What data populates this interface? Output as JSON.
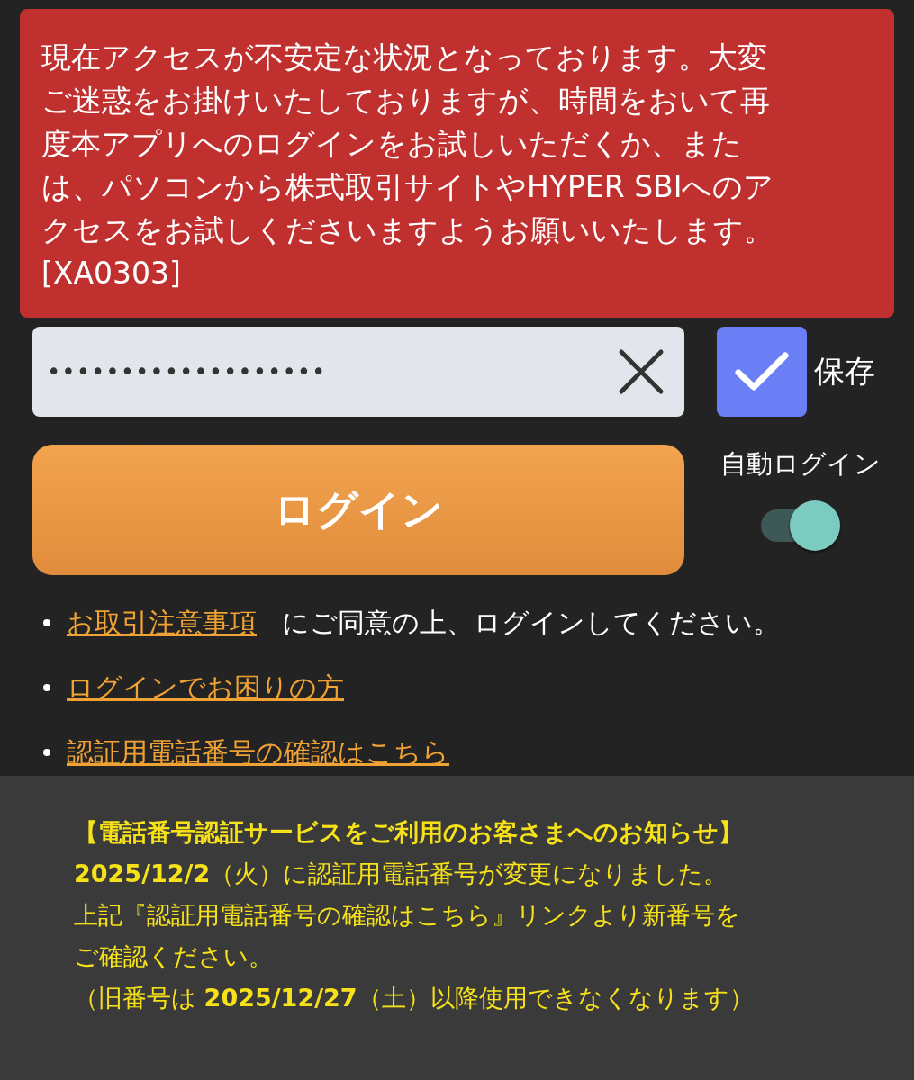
{
  "error_banner": {
    "message_lines": [
      "現在アクセスが不安定な状況となっております。大変",
      "ご迷惑をお掛けいたしておりますが、時間をおいて再",
      "度本アプリへのログインをお試しいただくか、また",
      "は、パソコンから株式取引サイトやHYPER SBIへのア",
      "クセスをお試しくださいますようお願いいたします。",
      "[XA0303]"
    ]
  },
  "password_field": {
    "value": "•••••••••••••••••••"
  },
  "save_checkbox": {
    "label": "保存",
    "checked": true
  },
  "login_button": {
    "label": "ログイン"
  },
  "auto_login": {
    "label": "自動ログイン",
    "on": true
  },
  "links": [
    {
      "link": "お取引注意事項",
      "text": "にご同意の上、ログインしてください。"
    },
    {
      "link": "ログインでお困りの方"
    },
    {
      "link": "認証用電話番号の確認はこちら"
    }
  ],
  "notice": {
    "title": "【電話番号認証サービスをご利用のお客さまへのお知らせ】",
    "lines": [
      "**2025/12/2**（火）に認証用電話番号が変更になりました。",
      "上記『認証用電話番号の確認はこちら』リンクより新番号を",
      "ご確認ください。",
      "（旧番号は **2025/12/27**（土）以降使用できなくなります）"
    ]
  }
}
